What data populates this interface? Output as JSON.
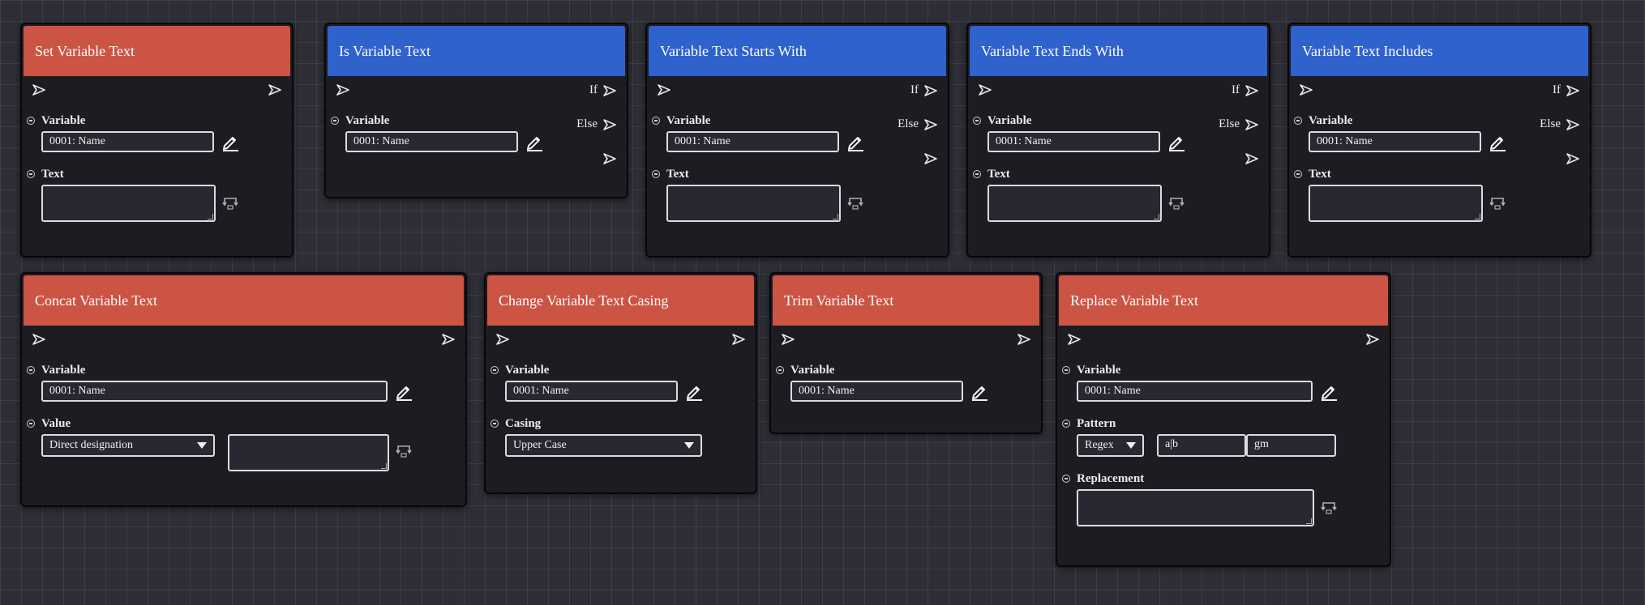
{
  "nodes": {
    "set_text": {
      "title": "Set Variable Text",
      "variable_label": "Variable",
      "variable_value": "0001: Name",
      "text_label": "Text"
    },
    "is_text": {
      "title": "Is Variable Text",
      "if_label": "If",
      "else_label": "Else",
      "variable_label": "Variable",
      "variable_value": "0001: Name"
    },
    "starts_with": {
      "title": "Variable Text Starts With",
      "if_label": "If",
      "else_label": "Else",
      "variable_label": "Variable",
      "variable_value": "0001: Name",
      "text_label": "Text"
    },
    "ends_with": {
      "title": "Variable Text Ends With",
      "if_label": "If",
      "else_label": "Else",
      "variable_label": "Variable",
      "variable_value": "0001: Name",
      "text_label": "Text"
    },
    "includes": {
      "title": "Variable Text Includes",
      "if_label": "If",
      "else_label": "Else",
      "variable_label": "Variable",
      "variable_value": "0001: Name",
      "text_label": "Text"
    },
    "concat": {
      "title": "Concat Variable Text",
      "variable_label": "Variable",
      "variable_value": "0001: Name",
      "value_label": "Value",
      "value_select": "Direct designation"
    },
    "casing": {
      "title": "Change Variable Text Casing",
      "variable_label": "Variable",
      "variable_value": "0001: Name",
      "casing_label": "Casing",
      "casing_select": "Upper Case"
    },
    "trim": {
      "title": "Trim Variable Text",
      "variable_label": "Variable",
      "variable_value": "0001: Name"
    },
    "replace": {
      "title": "Replace Variable Text",
      "variable_label": "Variable",
      "variable_value": "0001: Name",
      "pattern_label": "Pattern",
      "pattern_mode": "Regex",
      "pattern_value": "a|b",
      "flags_value": "gm",
      "replacement_label": "Replacement"
    }
  },
  "colors": {
    "action_header": "#cc5444",
    "condition_header": "#2f62cc"
  }
}
